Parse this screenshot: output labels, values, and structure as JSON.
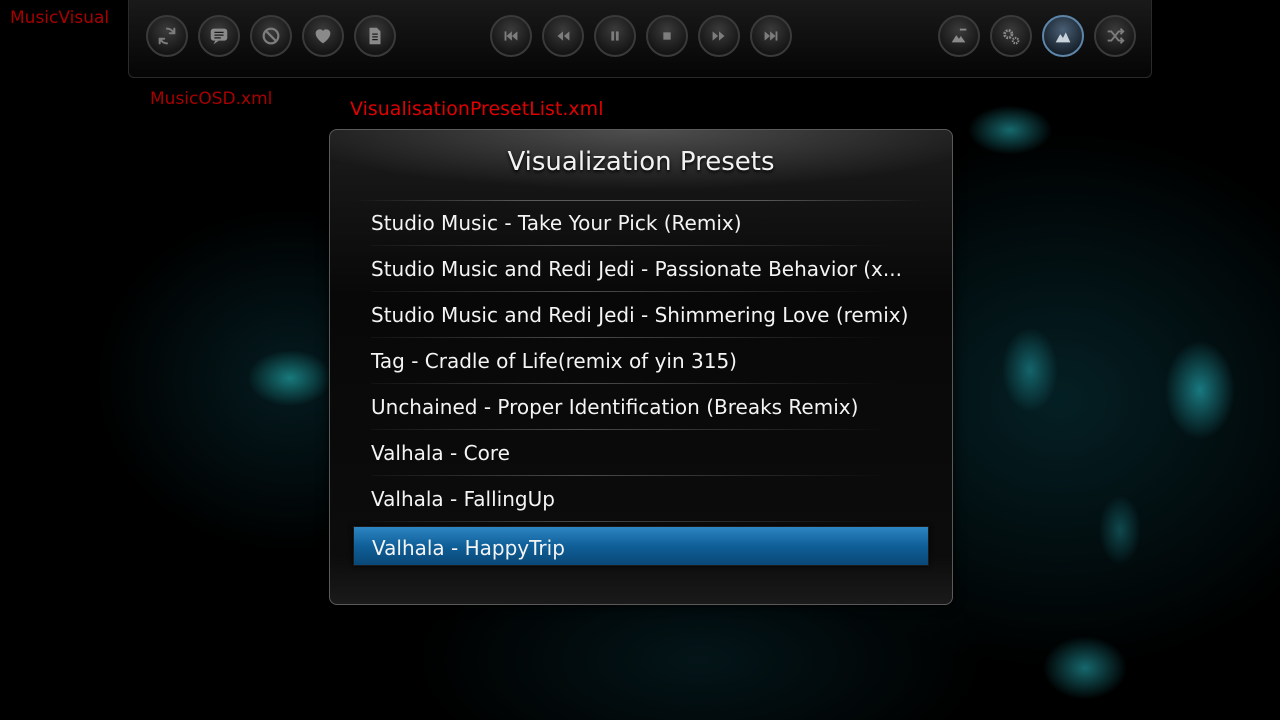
{
  "window_label": "MusicVisual",
  "osd_file_label": "MusicOSD.xml",
  "dialog_file_label": "VisualisationPresetList.xml",
  "osd": {
    "left_buttons": [
      {
        "icon": "refresh-icon"
      },
      {
        "icon": "chat-bubble-icon"
      },
      {
        "icon": "ban-icon"
      },
      {
        "icon": "heart-icon"
      },
      {
        "icon": "document-icon"
      }
    ],
    "transport_buttons": [
      {
        "icon": "skip-previous-icon"
      },
      {
        "icon": "rewind-icon"
      },
      {
        "icon": "pause-icon"
      },
      {
        "icon": "stop-icon"
      },
      {
        "icon": "fast-forward-icon"
      },
      {
        "icon": "skip-next-icon"
      }
    ],
    "right_buttons": [
      {
        "icon": "visualization-settings-icon"
      },
      {
        "icon": "gears-icon"
      },
      {
        "icon": "presets-icon",
        "active": true
      },
      {
        "icon": "shuffle-icon"
      }
    ]
  },
  "dialog": {
    "title": "Visualization Presets",
    "items": [
      {
        "label": "Studio Music - Take Your Pick (Remix)"
      },
      {
        "label": "Studio Music and Redi Jedi - Passionate Behavior (x..."
      },
      {
        "label": "Studio Music and Redi Jedi - Shimmering Love (remix)"
      },
      {
        "label": "Tag - Cradle of Life(remix of yin 315)"
      },
      {
        "label": "Unchained - Proper Identification (Breaks Remix)"
      },
      {
        "label": "Valhala - Core"
      },
      {
        "label": "Valhala - FallingUp"
      },
      {
        "label": "Valhala - HappyTrip",
        "selected": true
      }
    ]
  },
  "colors": {
    "accent": "#1f6fa8",
    "debug_label": "#e00000"
  }
}
